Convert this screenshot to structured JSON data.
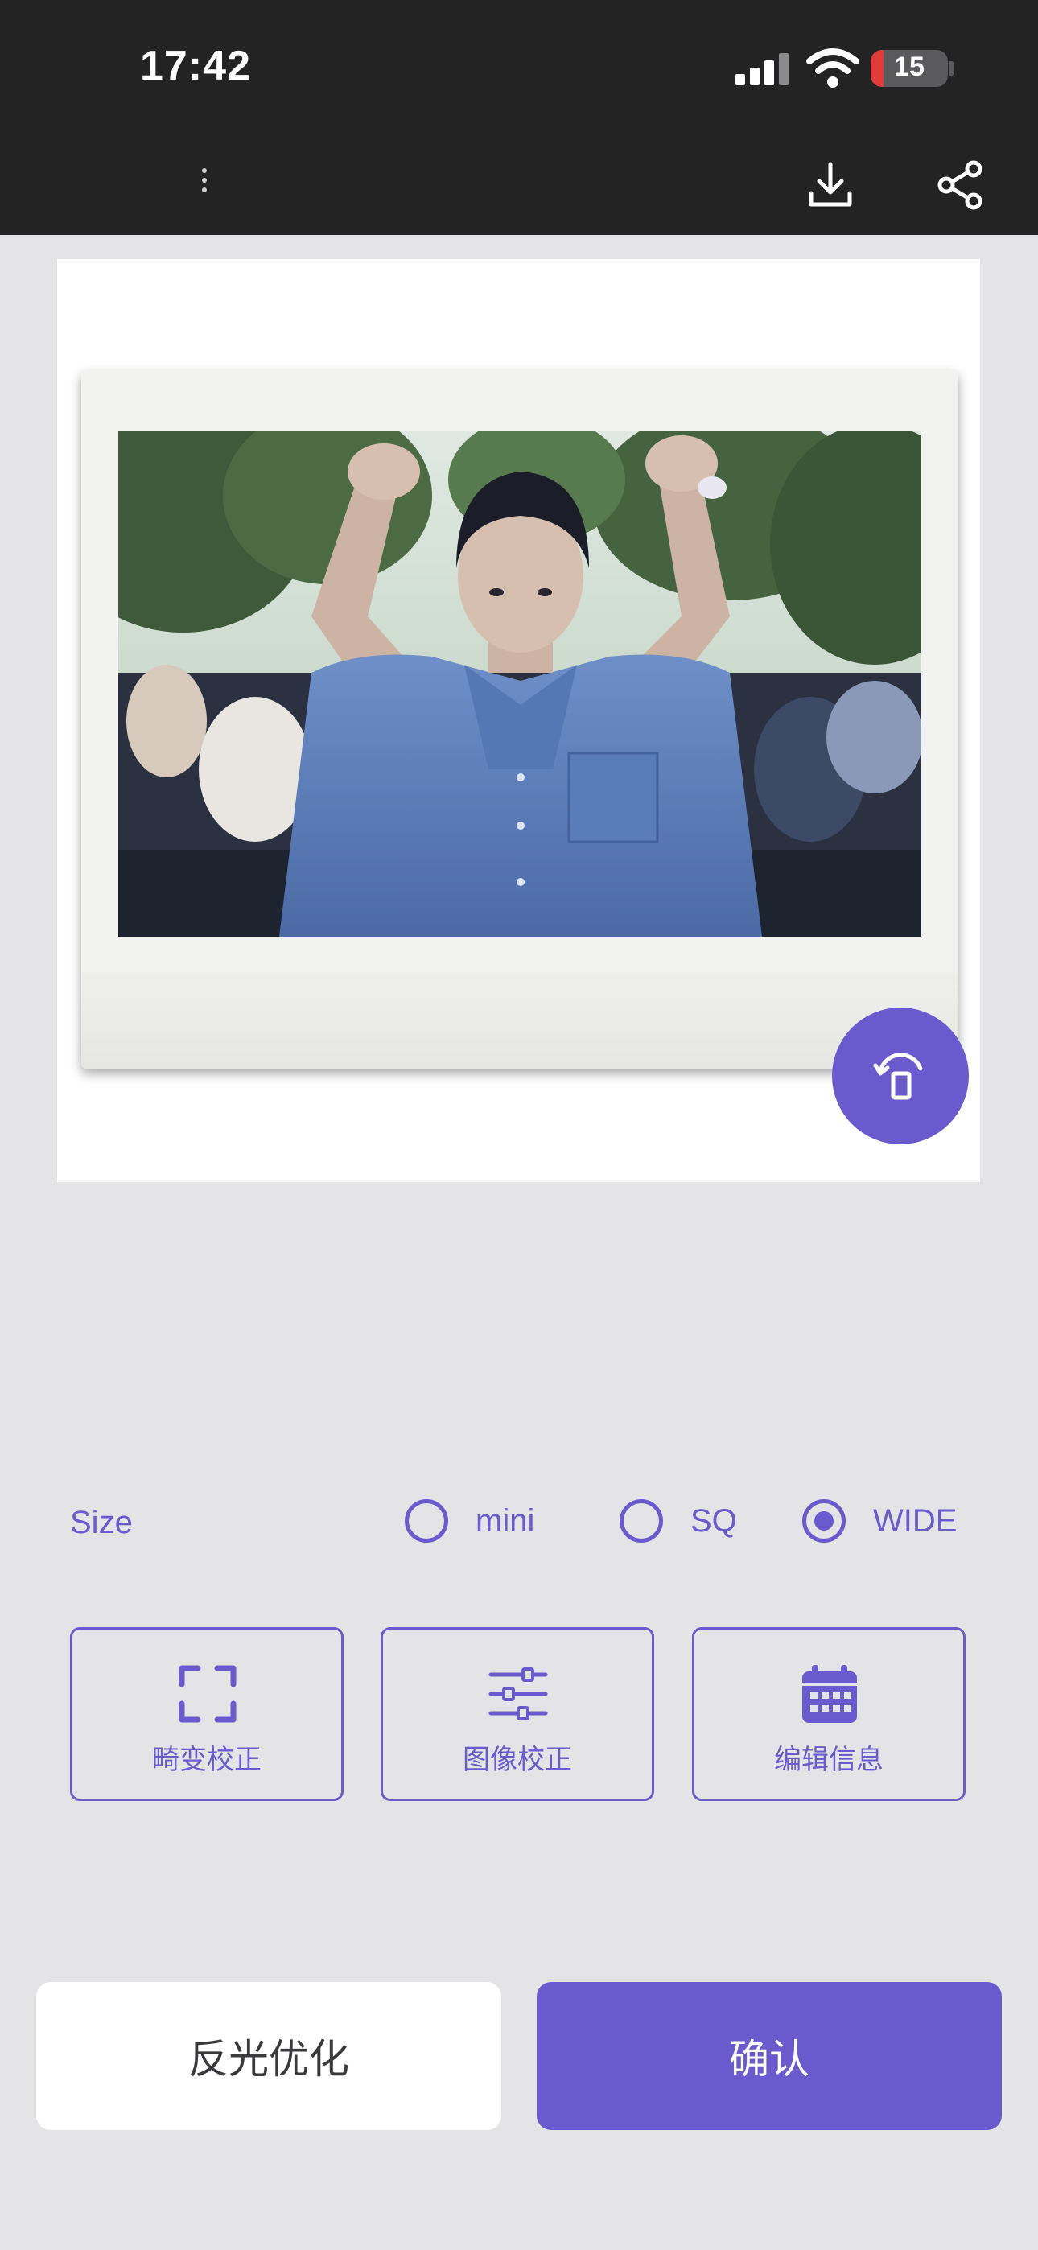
{
  "status_bar": {
    "time": "17:42",
    "battery": "15",
    "icons": [
      "signal-icon",
      "wifi-icon",
      "battery-icon"
    ]
  },
  "toolbar": {
    "icons": [
      "more-vertical-icon",
      "download-icon",
      "share-icon"
    ]
  },
  "preview": {
    "rotate_icon": "rotate-icon",
    "accent_color": "#6a5acd"
  },
  "size": {
    "label": "Size",
    "options": [
      {
        "label": "mini",
        "selected": false
      },
      {
        "label": "SQ",
        "selected": false
      },
      {
        "label": "WIDE",
        "selected": true
      }
    ]
  },
  "tools": [
    {
      "label": "畸变校正",
      "icon": "distortion-frame-icon"
    },
    {
      "label": "图像校正",
      "icon": "sliders-icon"
    },
    {
      "label": "编辑信息",
      "icon": "calendar-icon"
    }
  ],
  "actions": {
    "secondary_label": "反光优化",
    "primary_label": "确认"
  }
}
